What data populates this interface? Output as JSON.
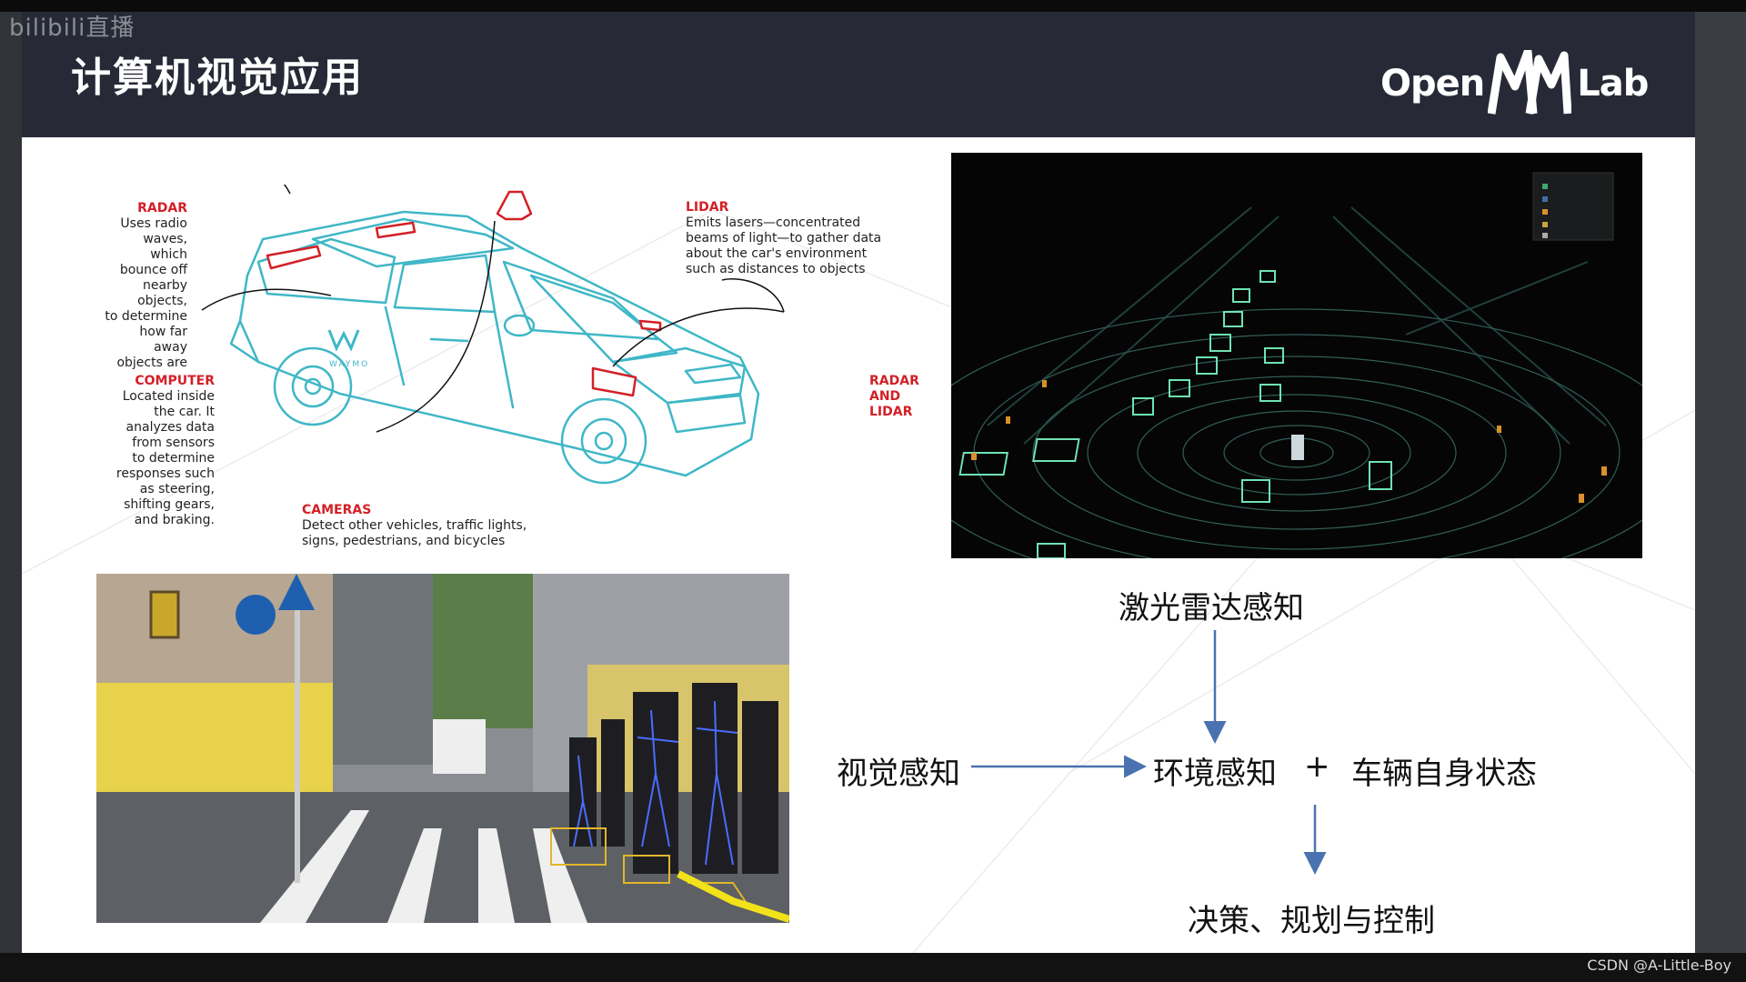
{
  "overlay": {
    "platform_logo": "bilibili直播",
    "credit": "CSDN @A-Little-Boy"
  },
  "slide": {
    "title": "计算机视觉应用",
    "logo": {
      "left": "Open",
      "middle": "M",
      "right": "Lab"
    }
  },
  "car_diagram": {
    "brand": "WAYMO",
    "radar": {
      "heading": "RADAR",
      "lines": [
        "Uses radio",
        "waves, which",
        "bounce off",
        "nearby objects,",
        "to determine",
        "how far away",
        "objects are"
      ]
    },
    "lidar": {
      "heading": "LIDAR",
      "lines": [
        "Emits lasers—concentrated",
        "beams of light—to gather data",
        "about the car's environment",
        "such as distances to objects"
      ]
    },
    "computer": {
      "heading": "COMPUTER",
      "lines": [
        "Located inside",
        "the car. It",
        "analyzes data",
        "from sensors",
        "to determine",
        "responses such",
        "as steering,",
        "shifting gears,",
        "and braking."
      ]
    },
    "radar_lidar": {
      "lines": [
        "RADAR",
        "AND",
        "LIDAR"
      ]
    },
    "cameras": {
      "heading": "CAMERAS",
      "lines": [
        "Detect other vehicles, traffic lights,",
        "signs, pedestrians, and bicycles"
      ]
    }
  },
  "flow": {
    "lidar_perception": "激光雷达感知",
    "visual_perception": "视觉感知",
    "environment_perception": "环境感知",
    "plus": "+",
    "vehicle_state": "车辆自身状态",
    "decision": "决策、规划与控制"
  },
  "colors": {
    "header_bg": "#272a36",
    "accent_red": "#d32027",
    "car_line": "#3fb7c7",
    "arrow_blue": "#4a72b0"
  }
}
